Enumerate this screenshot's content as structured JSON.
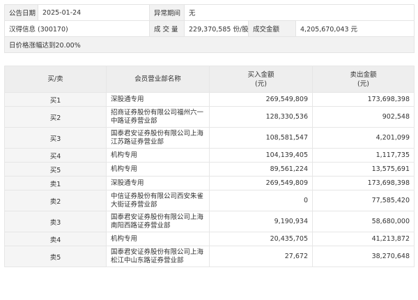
{
  "info": {
    "date_label": "公告日期",
    "date_value": "2025-01-24",
    "abnormal_label": "异常期间",
    "abnormal_value": "无",
    "stock_name": "汉得信息 (300170)",
    "volume_label": "成 交 量",
    "volume_value": "229,370,585 份/股",
    "amount_label": "成交金额",
    "amount_value": "4,205,670,043 元",
    "reason": "日价格涨幅达到20.00%"
  },
  "table": {
    "headers": {
      "side": "买/卖",
      "branch": "会员营业部名称",
      "buy_line1": "买入金额",
      "buy_line2": "(元)",
      "sell_line1": "卖出金额",
      "sell_line2": "(元)"
    },
    "rows": [
      {
        "side": "买1",
        "branch": "深股通专用",
        "buy": "269,549,809",
        "sell": "173,698,398",
        "tall": false
      },
      {
        "side": "买2",
        "branch": "招商证券股份有限公司福州六一中路证券营业部",
        "buy": "128,330,536",
        "sell": "902,548",
        "tall": true
      },
      {
        "side": "买3",
        "branch": "国泰君安证券股份有限公司上海江苏路证券营业部",
        "buy": "108,581,547",
        "sell": "4,201,099",
        "tall": true
      },
      {
        "side": "买4",
        "branch": "机构专用",
        "buy": "104,139,405",
        "sell": "1,117,735",
        "tall": false
      },
      {
        "side": "买5",
        "branch": "机构专用",
        "buy": "89,561,224",
        "sell": "13,575,691",
        "tall": false
      },
      {
        "side": "卖1",
        "branch": "深股通专用",
        "buy": "269,549,809",
        "sell": "173,698,398",
        "tall": false
      },
      {
        "side": "卖2",
        "branch": "中信证券股份有限公司西安朱雀大街证券营业部",
        "buy": "0",
        "sell": "77,585,420",
        "tall": true
      },
      {
        "side": "卖3",
        "branch": "国泰君安证券股份有限公司上海南阳西路证券营业部",
        "buy": "9,190,934",
        "sell": "58,680,000",
        "tall": true
      },
      {
        "side": "卖4",
        "branch": "机构专用",
        "buy": "20,435,705",
        "sell": "41,213,872",
        "tall": false
      },
      {
        "side": "卖5",
        "branch": "国泰君安证券股份有限公司上海松江中山东路证券营业部",
        "buy": "27,672",
        "sell": "38,270,648",
        "tall": true
      }
    ]
  }
}
